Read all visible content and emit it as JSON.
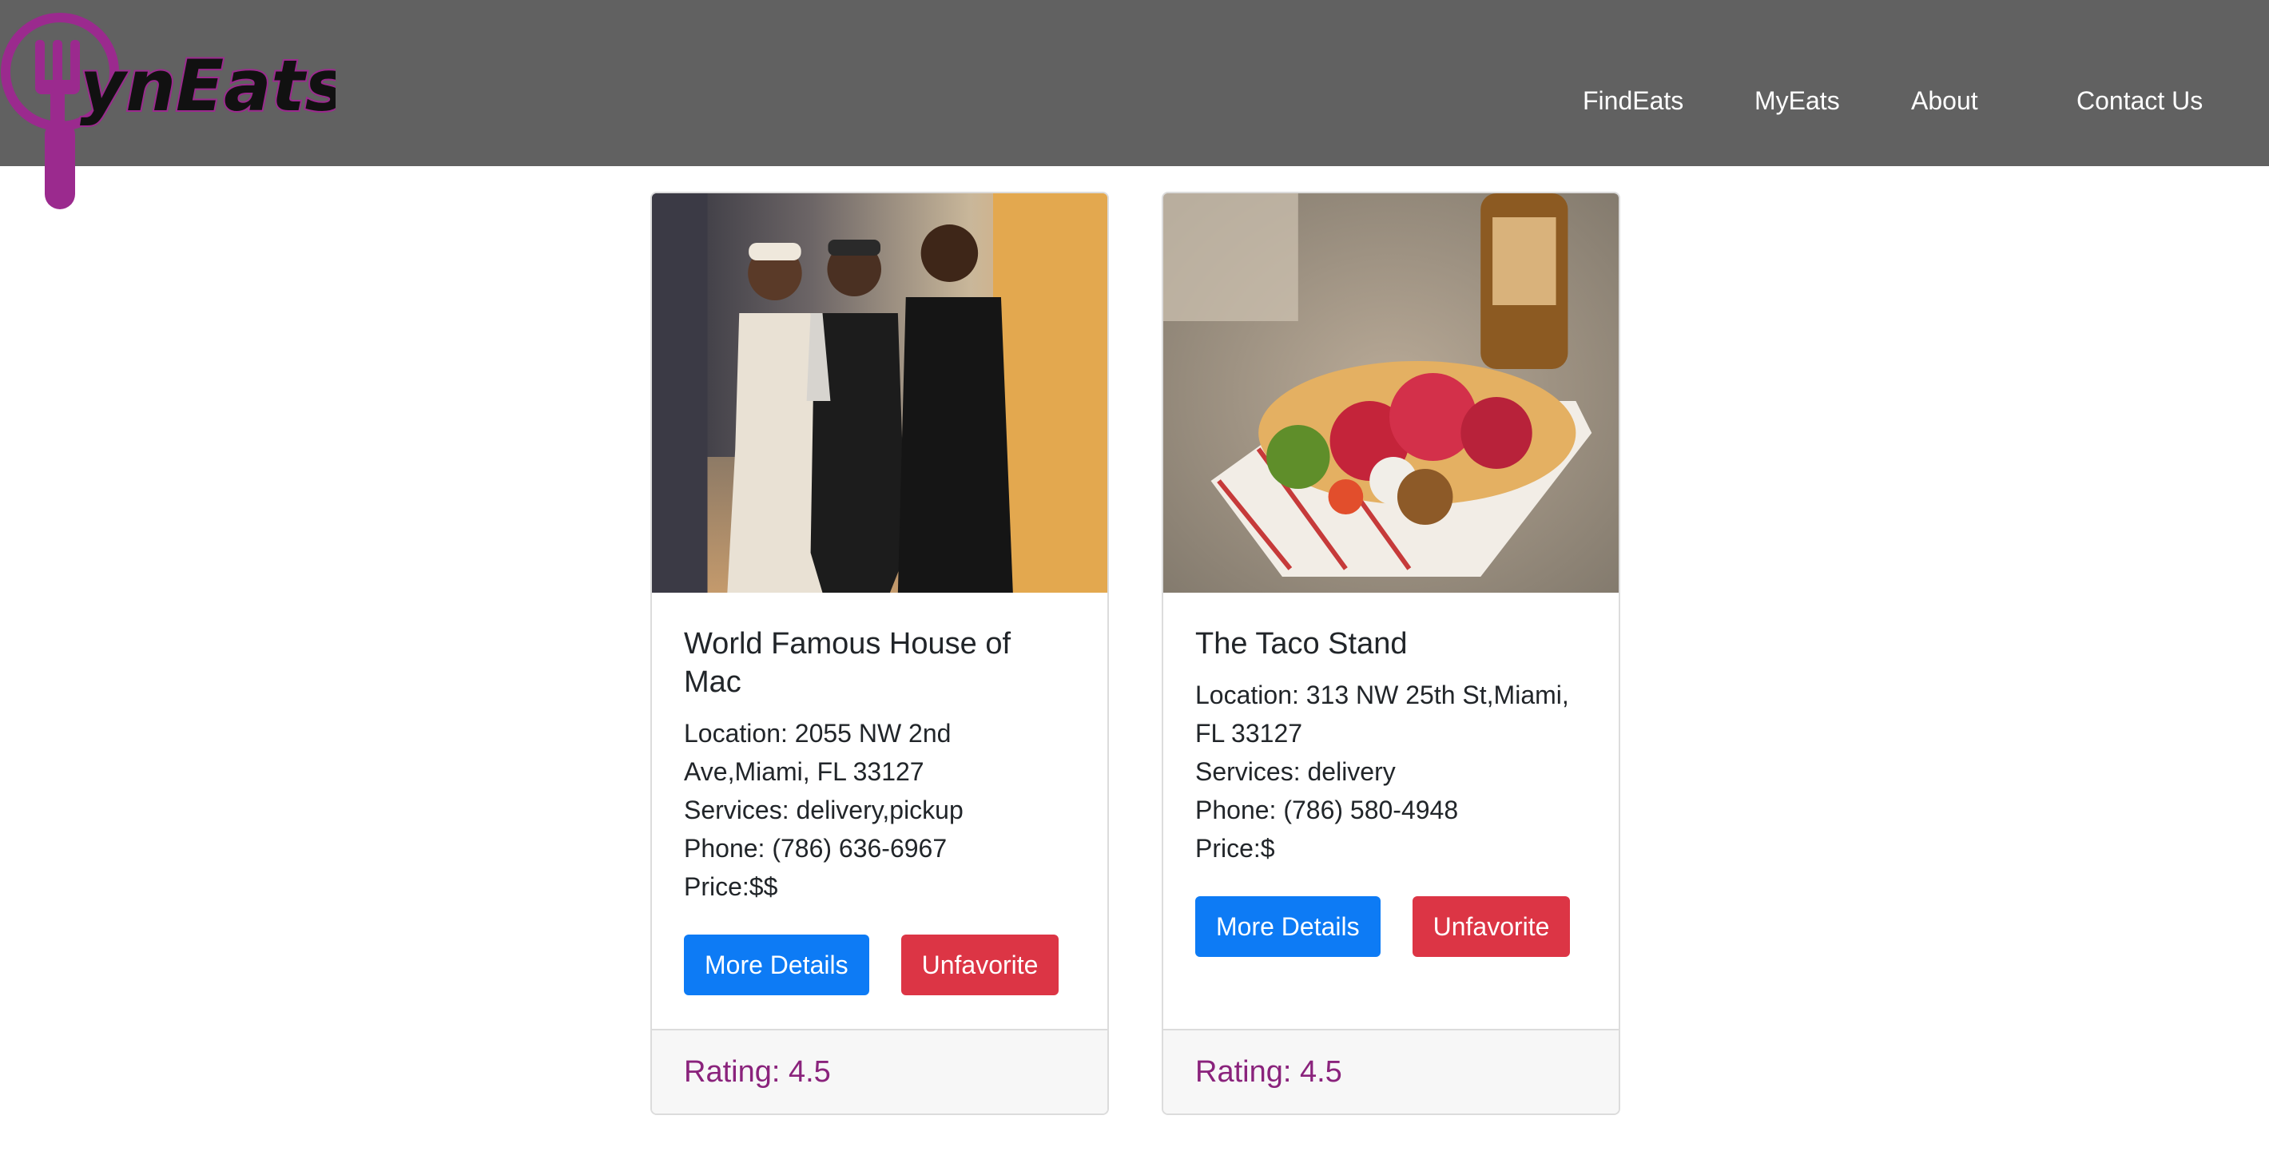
{
  "brand": {
    "logo_text": "ynEats",
    "logo_color": "#9b2a8e"
  },
  "nav": {
    "items": [
      {
        "label": "FindEats"
      },
      {
        "label": "MyEats"
      },
      {
        "label": "About"
      },
      {
        "label": "Contact Us"
      }
    ]
  },
  "cards": [
    {
      "title": "World Famous House of Mac",
      "location": "Location: 2055 NW 2nd Ave,Miami, FL 33127",
      "services": "Services: delivery,pickup",
      "phone": "Phone: (786) 636-6967",
      "price": "Price:$$",
      "details_label": "More Details",
      "unfavorite_label": "Unfavorite",
      "rating": "Rating: 4.5"
    },
    {
      "title": "The Taco Stand",
      "location": "Location: 313 NW 25th St,Miami, FL 33127",
      "services": "Services: delivery",
      "phone": "Phone: (786) 580-4948",
      "price": "Price:$",
      "details_label": "More Details",
      "unfavorite_label": "Unfavorite",
      "rating": "Rating: 4.5"
    }
  ],
  "colors": {
    "navbar": "#616161",
    "primary": "#0d7bf5",
    "danger": "#dc3545",
    "rating": "#8a237c"
  }
}
